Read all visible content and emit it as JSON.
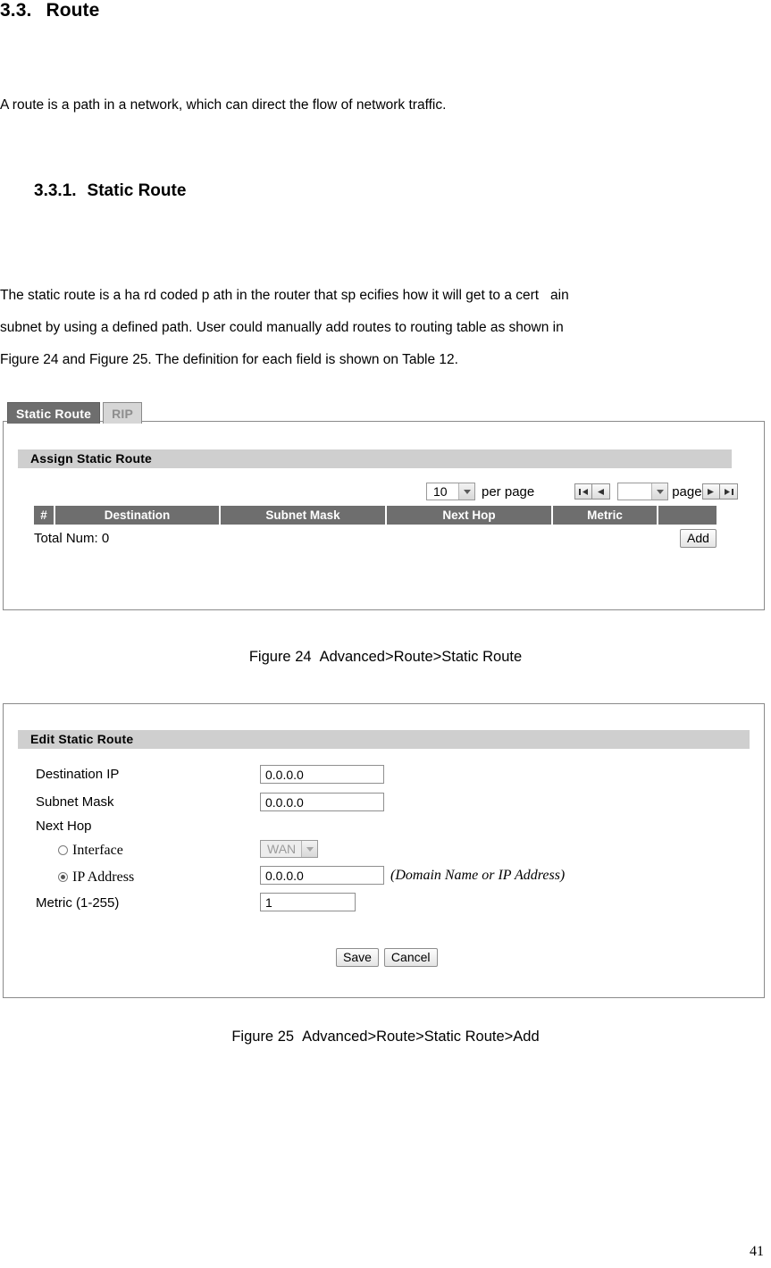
{
  "document": {
    "heading2": {
      "number": "3.3.",
      "title": "Route"
    },
    "intro_paragraph": "A route is a path in a network, which can direct the flow of network traffic.",
    "heading3": {
      "number": "3.3.1.",
      "title": "Static Route"
    },
    "static_paragraph_lines": [
      "The static route is a ha rd coded p ath in the router that sp ecifies how it will get to a cert   ain",
      "subnet by using a defined path. User could manually add routes to routing table as shown in",
      "Figure 24 and Figure 25. The definition for each field is shown on Table 12."
    ],
    "figure_24_caption": {
      "label": "Figure 24",
      "text": "Advanced>Route>Static Route"
    },
    "figure_25_caption": {
      "label": "Figure 25",
      "text": "Advanced>Route>Static Route>Add"
    },
    "page_number": "41"
  },
  "figure24": {
    "tabs": [
      {
        "label": "Static Route",
        "active": true
      },
      {
        "label": "RIP",
        "active": false
      }
    ],
    "section_title": "Assign Static Route",
    "pager": {
      "per_page_value": "10",
      "per_page_label": "per page",
      "page_select_value": "",
      "page_label": "page",
      "first_icon": "first-page-icon",
      "prev_icon": "previous-page-icon",
      "next_icon": "next-page-icon",
      "last_icon": "last-page-icon"
    },
    "table": {
      "columns": [
        "#",
        "Destination",
        "Subnet Mask",
        "Next Hop",
        "Metric",
        ""
      ],
      "rows": [],
      "total_label": "Total Num: 0"
    },
    "add_button_label": "Add"
  },
  "figure25": {
    "section_title": "Edit Static Route",
    "fields": {
      "destination_ip_label": "Destination IP",
      "destination_ip_value": "0.0.0.0",
      "subnet_mask_label": "Subnet Mask",
      "subnet_mask_value": "0.0.0.0",
      "next_hop_label": "Next Hop",
      "interface_radio_label": "Interface",
      "interface_select_value": "WAN",
      "ip_address_radio_label": "IP Address",
      "ip_address_value": "0.0.0.0",
      "ip_address_hint": "(Domain Name or IP Address)",
      "metric_label": "Metric (1-255)",
      "metric_value": "1"
    },
    "save_button_label": "Save",
    "cancel_button_label": "Cancel"
  },
  "colors": {
    "tab_active_bg": "#6e6e6e",
    "tab_inactive_bg": "#d6d6d6",
    "section_bar_bg": "#cfcfcf",
    "table_header_bg": "#6e6e6e",
    "panel_border": "#8a8a8a"
  }
}
